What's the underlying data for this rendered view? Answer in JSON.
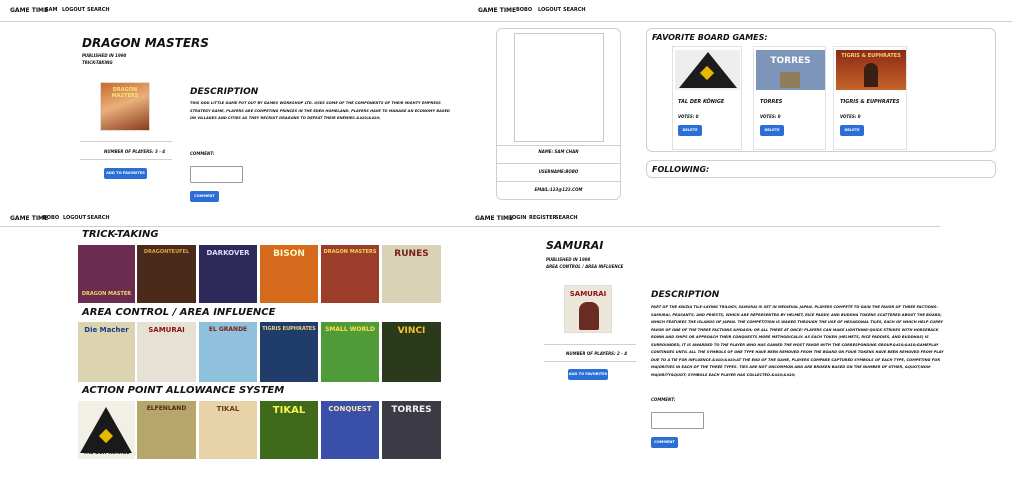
{
  "nav_user": {
    "brand": "Game Time",
    "user": "Sam",
    "logout": "Logout",
    "search": "Search"
  },
  "nav_user2": {
    "brand": "Game Time",
    "user": "Bobo",
    "logout": "Logout",
    "search": "Search"
  },
  "nav_user3": {
    "brand": "Game Time",
    "user": "Bobo",
    "logout": "Logout",
    "search": "Search"
  },
  "nav_guest": {
    "brand": "Game Time",
    "login": "Login",
    "register": "Register",
    "search": "Search"
  },
  "game1": {
    "title": "Dragon Masters",
    "published": "Published in 1990",
    "category": "Trick-taking",
    "description_heading": "Description",
    "description": "This odd little game put out by Games Workshop Ltd. Uses some of the components of their mighty Empress Strategy game, players are competing princes in the Eden homeland. Players have to manage an economy based on villages and cities as they recruit dragons to defeat their enemies.&#10;&#10;",
    "players": "Number of Players: 3 - 4",
    "add_button": "Add to Favorites",
    "comment_label": "Comment:",
    "comment_button": "Comment"
  },
  "profile": {
    "name": "Name: Sam Chan",
    "username": "Username:Bobo",
    "email": "Email:123@123.com",
    "favorites_heading": "Favorite Board Games:",
    "favorites": [
      {
        "title": "Tal der Könige",
        "votes": "Votes: 0",
        "button": "Delete",
        "cover": "TAL DER KÖNIGE",
        "bg": "#1a1a1a",
        "fg": "#f0c020"
      },
      {
        "title": "Torres",
        "votes": "Votes: 0",
        "button": "Delete",
        "cover": "TORRES",
        "bg": "#7d95b8",
        "fg": "#ffffff"
      },
      {
        "title": "Tigris & Euphrates",
        "votes": "Votes: 0",
        "button": "Delete",
        "cover": "TIGRIS & EUPHRATES",
        "bg": "#8c2a14",
        "fg": "#f3d27a"
      }
    ],
    "following_heading": "Following:"
  },
  "search": {
    "sections": [
      {
        "heading": "Trick-taking",
        "covers": [
          {
            "label": "DRAGON MASTER",
            "bg": "#6b2c4f",
            "fg": "#f5d56b"
          },
          {
            "label": "DRAGONTEUFEL",
            "bg": "#4a2a1a",
            "fg": "#e2a33b"
          },
          {
            "label": "DARKOVER",
            "bg": "#2c2858",
            "fg": "#e0d9ff"
          },
          {
            "label": "BISON",
            "bg": "#d66a1c",
            "fg": "#fff4c0"
          },
          {
            "label": "DRAGON MASTERS",
            "bg": "#9b3d2a",
            "fg": "#f6d35a"
          },
          {
            "label": "RUNES",
            "bg": "#d9d2b7",
            "fg": "#7a1d1d"
          }
        ]
      },
      {
        "heading": "Area Control / Area Influence",
        "covers": [
          {
            "label": "Die Macher",
            "bg": "#dcd4b0",
            "fg": "#1a3a8a"
          },
          {
            "label": "SAMURAI",
            "bg": "#e7e0d4",
            "fg": "#8c1111"
          },
          {
            "label": "EL GRANDE",
            "bg": "#8fc1dd",
            "fg": "#7b1f12"
          },
          {
            "label": "TIGRIS EUPHRATES",
            "bg": "#1f3c6b",
            "fg": "#f1d37c"
          },
          {
            "label": "SMALL WORLD",
            "bg": "#4f9b3a",
            "fg": "#ffe04a"
          },
          {
            "label": "VINCI",
            "bg": "#2a3a1a",
            "fg": "#f1c22b"
          }
        ]
      },
      {
        "heading": "Action Point Allowance System",
        "covers": [
          {
            "label": "TAL DER KÖNIGE",
            "bg": "#f1efe6",
            "fg": "#1a1a1a"
          },
          {
            "label": "ELFENLAND",
            "bg": "#b7a66b",
            "fg": "#4a2d12"
          },
          {
            "label": "TIKAL",
            "bg": "#e8d3a8",
            "fg": "#6b3a1a"
          },
          {
            "label": "TIKAL",
            "bg": "#3f6a1c",
            "fg": "#fff34a"
          },
          {
            "label": "CONQUEST",
            "bg": "#3a4fa8",
            "fg": "#f7e7b2"
          },
          {
            "label": "TORRES",
            "bg": "#3b3a45",
            "fg": "#f3f3f3"
          }
        ]
      }
    ]
  },
  "game2": {
    "title": "Samurai",
    "published": "Published in 1998",
    "category": "Area Control / Area Influence",
    "description_heading": "Description",
    "description": "Part of the Knizia tile-laying trilogy, Samurai is set in medieval Japan. Players compete to gain the favor of three factions: samurai, peasants, and priests, which are represented by helmet, rice paddy, and Buddha tokens scattered about the board, which features the islands of Japan. The competition is waged through the use of hexagonal tiles, each of which help curry favor of one of the three factions &mdash; or all three at once! Players can make lightning-quick strikes with horseback ronin and ships or approach their conquests more methodically. As each token (helmets, rice paddies, and Buddhas) is surrounded, it is awarded to the player who has gained the most favor with the corresponding group.&#10;&#10;Gameplay continues until all the symbols of one type have been removed from the board or four tokens have been removed from play due to a tie for influence.&#10;&#10;At the end of the game, players compare captured symbols of each type, competing for majorities in each of the three types. Ties are not uncommon and are broken based on the number of other, &quot;non-majority&quot; symbols each player has collected.&#10;&#10;",
    "players": "Number of Players: 2 - 4",
    "add_button": "Add to Favorites",
    "comment_label": "Comment:",
    "comment_button": "Comment"
  }
}
